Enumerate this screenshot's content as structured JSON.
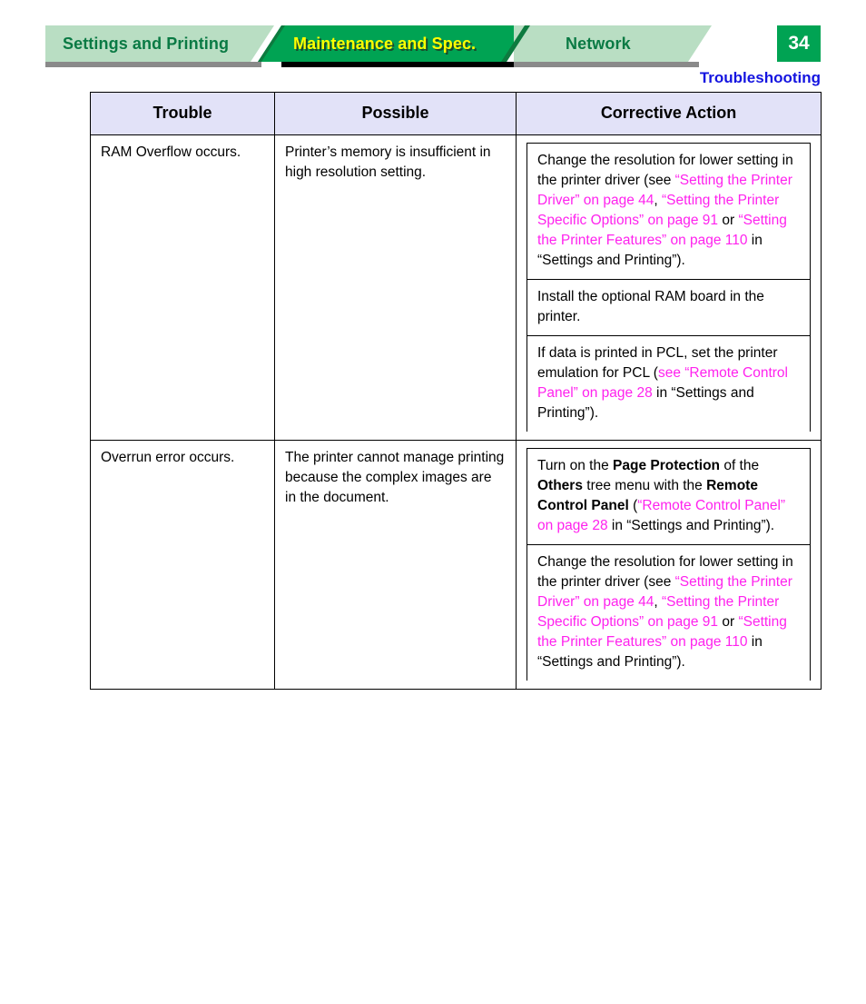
{
  "header": {
    "tabs": [
      {
        "label": "Settings and Printing",
        "state": "inactive"
      },
      {
        "label": "Maintenance and Spec.",
        "state": "active"
      },
      {
        "label": "Network",
        "state": "inactive"
      }
    ],
    "page_number": "34",
    "section_title": "Troubleshooting"
  },
  "colors": {
    "tab_active_bg": "#00a353",
    "tab_inactive_bg": "#b9dec3",
    "tab_active_text": "#ffff00",
    "tab_inactive_text": "#0a7a44",
    "link": "#ff22ee",
    "section_title": "#1414e0",
    "table_header_bg": "#e2e2f8"
  },
  "table": {
    "headers": [
      "Trouble",
      "Possible",
      "Corrective Action"
    ],
    "rows": [
      {
        "trouble": "RAM Overflow occurs.",
        "possible": "Printer’s memory is insufficient in high resolution setting.",
        "actions": [
          {
            "segments": [
              {
                "text": "Change the resolution for lower setting in the printer driver (see ",
                "style": "plain"
              },
              {
                "text": "“Setting the Printer Driver” on page 44",
                "style": "link"
              },
              {
                "text": ", ",
                "style": "plain"
              },
              {
                "text": "“Setting the Printer Specific Options” on page 91",
                "style": "link"
              },
              {
                "text": " or ",
                "style": "plain"
              },
              {
                "text": "“Setting the Printer Features” on page 110",
                "style": "link"
              },
              {
                "text": " in “Settings and Printing”).",
                "style": "plain"
              }
            ]
          },
          {
            "segments": [
              {
                "text": "Install the optional RAM board in the printer.",
                "style": "plain"
              }
            ]
          },
          {
            "segments": [
              {
                "text": "If data is printed in PCL, set the printer emulation for PCL (",
                "style": "plain"
              },
              {
                "text": "see “Remote Control Panel” on page 28",
                "style": "link"
              },
              {
                "text": " in “Settings and Printing”).",
                "style": "plain"
              }
            ]
          }
        ]
      },
      {
        "trouble": "Overrun error occurs.",
        "possible": "The printer cannot manage printing because the complex images are in the document.",
        "actions": [
          {
            "segments": [
              {
                "text": "Turn on the ",
                "style": "plain"
              },
              {
                "text": "Page Protection",
                "style": "bold"
              },
              {
                "text": " of the ",
                "style": "plain"
              },
              {
                "text": "Others",
                "style": "bold"
              },
              {
                "text": " tree menu with the ",
                "style": "plain"
              },
              {
                "text": "Remote Control Panel",
                "style": "bold"
              },
              {
                "text": " (",
                "style": "plain"
              },
              {
                "text": "“Remote Control Panel” on page 28",
                "style": "link"
              },
              {
                "text": " in “Settings and Printing”).",
                "style": "plain"
              }
            ]
          },
          {
            "segments": [
              {
                "text": "Change the resolution for lower setting in the printer driver (see ",
                "style": "plain"
              },
              {
                "text": "“Setting the Printer Driver” on page 44",
                "style": "link"
              },
              {
                "text": ", ",
                "style": "plain"
              },
              {
                "text": "“Setting the Printer Specific Options” on page 91",
                "style": "link"
              },
              {
                "text": " or ",
                "style": "plain"
              },
              {
                "text": "“Setting the Printer Features” on page 110",
                "style": "link"
              },
              {
                "text": " in “Settings and Printing”).",
                "style": "plain"
              }
            ]
          }
        ]
      }
    ]
  }
}
